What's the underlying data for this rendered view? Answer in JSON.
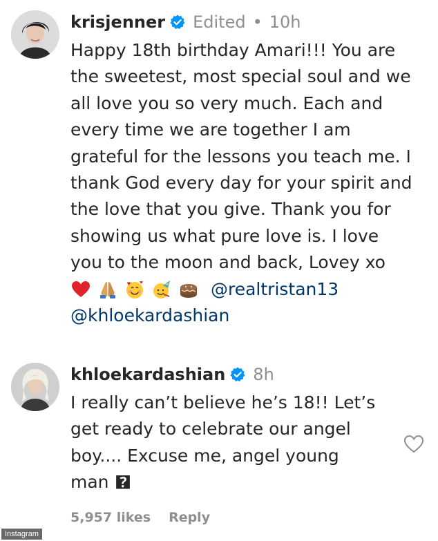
{
  "comments": [
    {
      "username": "krisjenner",
      "edited": "Edited",
      "separator": "•",
      "time": "10h",
      "lines": [
        "Happy 18th birthday Amari!!! You are",
        "the sweetest, most special soul and we",
        "all love you so very much. Each and",
        "every time we are together I am",
        "grateful for the lessons you teach me. I",
        "thank God every day for your spirit and",
        "the love that you give. Thank you for",
        "showing us what pure love is. I love",
        "you to the moon and back, Lovey xo"
      ],
      "emojis": [
        "red-heart",
        "folded-hands",
        "smiling-face-with-hearts",
        "face-with-party-hat",
        "birthday-cake"
      ],
      "mentions": [
        "@realtristan13",
        "@khloekardashian"
      ]
    },
    {
      "username": "khloekardashian",
      "time": "8h",
      "lines": [
        "I really can’t believe he’s 18!! Let’s",
        "get ready to celebrate our angel",
        "boy.... Excuse me, angel young",
        "man 🯄"
      ],
      "likes": "5,957 likes",
      "reply": "Reply"
    }
  ],
  "icons": {
    "verified": "verified-badge-icon",
    "like": "heart-outline-icon"
  },
  "colors": {
    "verified_blue": "#0095f6",
    "mention": "#00376b",
    "meta_gray": "#8e8e8e"
  },
  "watermark": "Instagram"
}
